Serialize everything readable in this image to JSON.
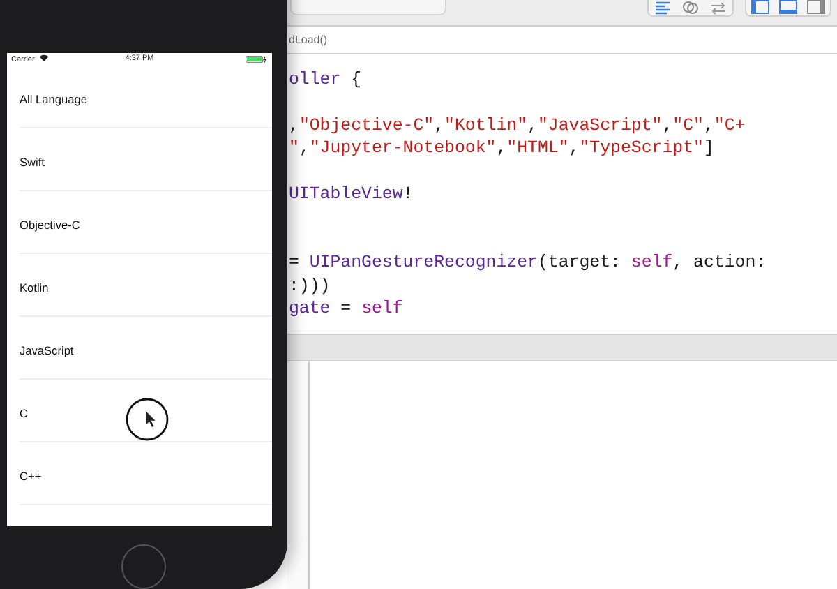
{
  "phone": {
    "status_bar": {
      "carrier": "Carrier",
      "time": "4:37 PM"
    },
    "rows": [
      "All Language",
      "Swift",
      "Objective-C",
      "Kotlin",
      "JavaScript",
      "C",
      "C++"
    ]
  },
  "editor": {
    "jump_bar": "dLoad()",
    "lines": [
      [
        {
          "kind": "type",
          "text": "oller"
        },
        {
          "kind": "plain",
          "text": " {"
        }
      ],
      [
        {
          "kind": "plain",
          "text": ","
        },
        {
          "kind": "string",
          "text": "\"Objective-C\""
        },
        {
          "kind": "plain",
          "text": ","
        },
        {
          "kind": "string",
          "text": "\"Kotlin\""
        },
        {
          "kind": "plain",
          "text": ","
        },
        {
          "kind": "string",
          "text": "\"JavaScript\""
        },
        {
          "kind": "plain",
          "text": ","
        },
        {
          "kind": "string",
          "text": "\"C\""
        },
        {
          "kind": "plain",
          "text": ","
        },
        {
          "kind": "string",
          "text": "\"C+"
        }
      ],
      [
        {
          "kind": "string",
          "text": "\""
        },
        {
          "kind": "plain",
          "text": ","
        },
        {
          "kind": "string",
          "text": "\"Jupyter-Notebook\""
        },
        {
          "kind": "plain",
          "text": ","
        },
        {
          "kind": "string",
          "text": "\"HTML\""
        },
        {
          "kind": "plain",
          "text": ","
        },
        {
          "kind": "string",
          "text": "\"TypeScript\""
        },
        {
          "kind": "plain",
          "text": "]"
        }
      ],
      [
        {
          "kind": "type",
          "text": "UITableView"
        },
        {
          "kind": "plain",
          "text": "!"
        }
      ],
      [
        {
          "kind": "plain",
          "text": "= "
        },
        {
          "kind": "type",
          "text": "UIPanGestureRecognizer"
        },
        {
          "kind": "plain",
          "text": "(target: "
        },
        {
          "kind": "keyword",
          "text": "self"
        },
        {
          "kind": "plain",
          "text": ", action:"
        }
      ],
      [
        {
          "kind": "plain",
          "text": ":)))"
        }
      ],
      [
        {
          "kind": "type",
          "text": "gate"
        },
        {
          "kind": "plain",
          "text": " = "
        },
        {
          "kind": "keyword",
          "text": "self"
        }
      ]
    ]
  }
}
